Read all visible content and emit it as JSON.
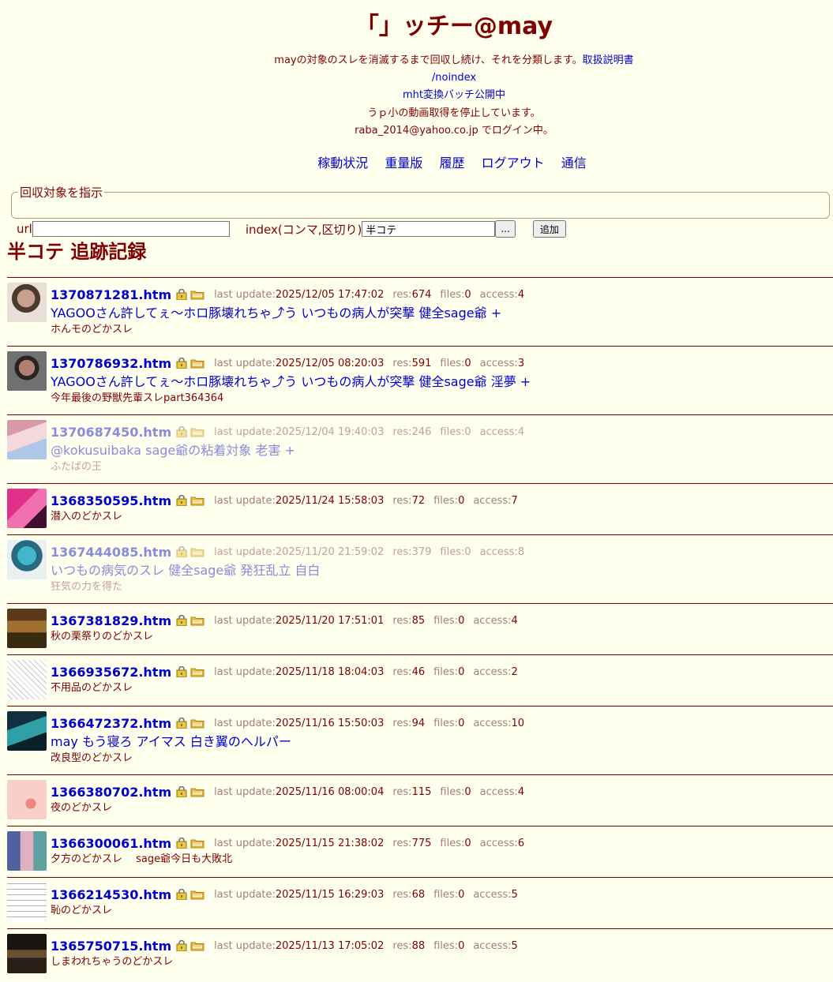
{
  "header": {
    "title": "「」ッチー@may",
    "line1_text": "mayの対象のスレを消滅するまで回収し続け、それを分類します。",
    "line1_link": "取扱説明書",
    "noindex_link": "/noindex",
    "mht_link": "mht変換バッチ公開中",
    "notice": "うｐ小の動画取得を停止しています。",
    "login_status": "raba_2014@yahoo.co.jp でログイン中。"
  },
  "nav": {
    "items": [
      "稼動状況",
      "重量版",
      "履歴",
      "ログアウト",
      "通信"
    ]
  },
  "add_form": {
    "legend": "回収対象を指示",
    "url_label": "url",
    "url_value": "",
    "index_label": "index(コンマ,区切り)",
    "index_value": "半コテ",
    "browse_label": "...",
    "add_label": "追加"
  },
  "page": {
    "heading": "半コテ 追跡記録"
  },
  "labels": {
    "last_update": "last update:",
    "res": "res:",
    "files": "files:",
    "access": "access:"
  },
  "threads": [
    {
      "file": "1370871281.htm",
      "last_update": "2025/12/05 17:47:02",
      "res": "674",
      "files": "0",
      "access": "4",
      "tags": "YAGOOさん許してぇ～ホロ豚壊れちゃ⤴う いつもの病人が突撃 健全sage爺 +",
      "desc": "ホんモのどかスレ",
      "faded": false,
      "thumb": "photo-man-1"
    },
    {
      "file": "1370786932.htm",
      "last_update": "2025/12/05 08:20:03",
      "res": "591",
      "files": "0",
      "access": "3",
      "tags": "YAGOOさん許してぇ～ホロ豚壊れちゃ⤴う いつもの病人が突撃 健全sage爺 淫夢 +",
      "desc": "今年最後の野獣先輩スレpart364364",
      "faded": false,
      "thumb": "photo-man-2"
    },
    {
      "file": "1370687450.htm",
      "last_update": "2025/12/04 19:40:03",
      "res": "246",
      "files": "0",
      "access": "4",
      "tags": "@kokusuibaka sage爺の粘着対象 老害 +",
      "desc": "ふたばの王",
      "faded": true,
      "thumb": "anime-girl-pink"
    },
    {
      "file": "1368350595.htm",
      "last_update": "2025/11/24 15:58:03",
      "res": "72",
      "files": "0",
      "access": "7",
      "tags": "",
      "desc": "潜入のどかスレ",
      "faded": false,
      "thumb": "anime-magenta"
    },
    {
      "file": "1367444085.htm",
      "last_update": "2025/11/20 21:59:02",
      "res": "379",
      "files": "0",
      "access": "8",
      "tags": "いつもの病気のスレ 健全sage爺 発狂乱立 自白",
      "desc": "狂気の力を得た",
      "faded": true,
      "thumb": "robot-teal"
    },
    {
      "file": "1367381829.htm",
      "last_update": "2025/11/20 17:51:01",
      "res": "85",
      "files": "0",
      "access": "4",
      "tags": "",
      "desc": "秋の栗祭りのどかスレ",
      "faded": false,
      "thumb": "autumn-scene"
    },
    {
      "file": "1366935672.htm",
      "last_update": "2025/11/18 18:04:03",
      "res": "46",
      "files": "0",
      "access": "2",
      "tags": "",
      "desc": "不用品のどかスレ",
      "faded": false,
      "thumb": "manga-lineart"
    },
    {
      "file": "1366472372.htm",
      "last_update": "2025/11/16 15:50:03",
      "res": "94",
      "files": "0",
      "access": "10",
      "tags": "may もう寝ろ アイマス 白き翼のヘルパー",
      "desc": "改良型のどかスレ",
      "faded": false,
      "thumb": "anime-teal-hair"
    },
    {
      "file": "1366380702.htm",
      "last_update": "2025/11/16 08:00:04",
      "res": "115",
      "files": "0",
      "access": "4",
      "tags": "",
      "desc": "夜のどかスレ",
      "faded": false,
      "thumb": "closeup-skin"
    },
    {
      "file": "1366300061.htm",
      "last_update": "2025/11/15 21:38:02",
      "res": "775",
      "files": "0",
      "access": "6",
      "tags": "",
      "desc": "夕方のどかスレ　  sage爺今日も大敗北",
      "faded": false,
      "thumb": "anime-group"
    },
    {
      "file": "1366214530.htm",
      "last_update": "2025/11/15 16:29:03",
      "res": "68",
      "files": "0",
      "access": "5",
      "tags": "",
      "desc": "恥のどかスレ",
      "faded": false,
      "thumb": "manga-page"
    },
    {
      "file": "1365750715.htm",
      "last_update": "2025/11/13 17:05:02",
      "res": "88",
      "files": "0",
      "access": "5",
      "tags": "",
      "desc": "しまわれちゃうのどかスレ",
      "faded": false,
      "thumb": "dark-room"
    }
  ],
  "colors": {
    "background": "#ffffee",
    "text": "#800000",
    "link": "#0000cc",
    "faded_link": "#8a8ae0"
  }
}
